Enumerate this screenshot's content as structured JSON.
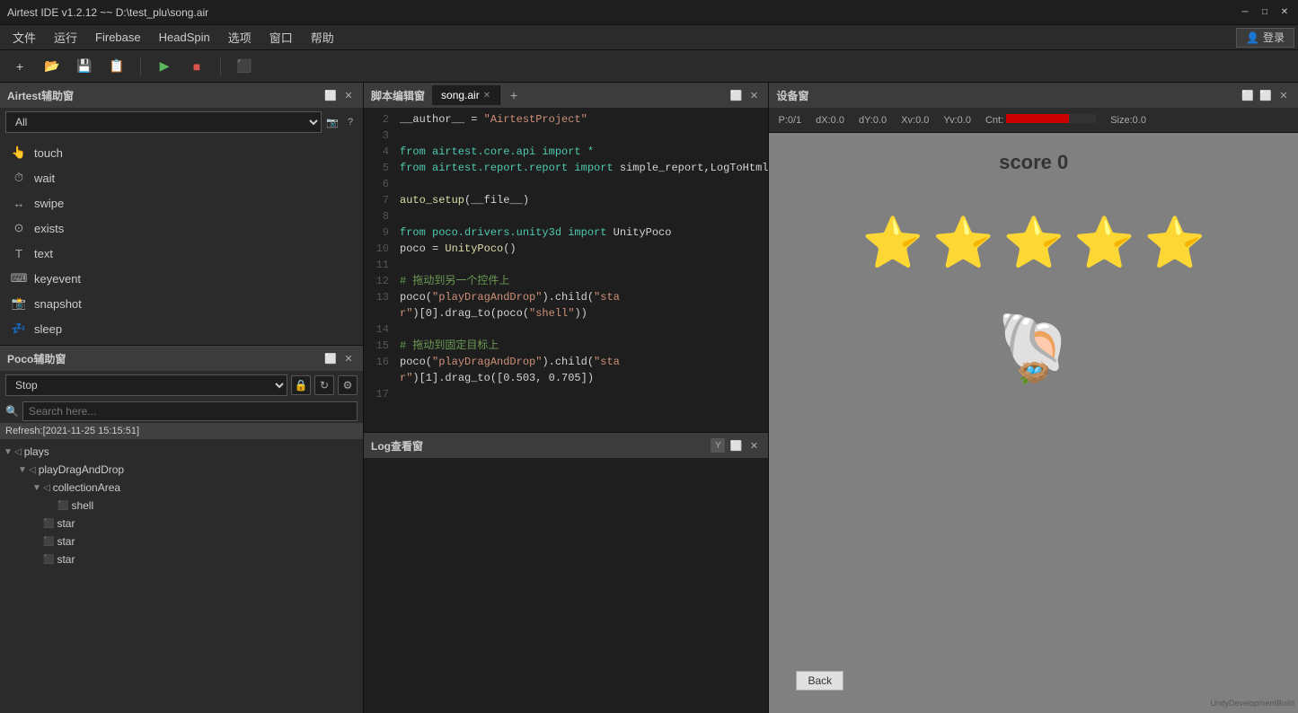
{
  "titleBar": {
    "title": "Airtest IDE v1.2.12 ~~ D:\\test_plu\\song.air",
    "minimize": "─",
    "maximize": "□",
    "close": "✕"
  },
  "menuBar": {
    "items": [
      "文件",
      "运行",
      "Firebase",
      "HeadSpin",
      "选项",
      "窗口",
      "帮助"
    ]
  },
  "toolbar": {
    "new_label": "+",
    "open_label": "📂",
    "save_label": "💾",
    "saveas_label": "📋",
    "run_label": "▶",
    "stop_label": "■",
    "record_label": "⬛",
    "login_label": "登录"
  },
  "airtestPanel": {
    "title": "Airtest辅助窗",
    "filterPlaceholder": "All",
    "items": [
      {
        "icon": "touch-icon",
        "label": "touch"
      },
      {
        "icon": "wait-icon",
        "label": "wait"
      },
      {
        "icon": "swipe-icon",
        "label": "swipe"
      },
      {
        "icon": "exists-icon",
        "label": "exists"
      },
      {
        "icon": "text-icon",
        "label": "text"
      },
      {
        "icon": "keyevent-icon",
        "label": "keyevent"
      },
      {
        "icon": "snapshot-icon",
        "label": "snapshot"
      },
      {
        "icon": "sleep-icon",
        "label": "sleep"
      }
    ]
  },
  "pocoPanel": {
    "title": "Poco辅助窗",
    "selectValue": "Stop",
    "searchPlaceholder": "Search here...",
    "refreshLabel": "Refresh:[2021-11-25 15:15:51]",
    "tree": [
      {
        "level": 0,
        "expanded": true,
        "icon": "▼",
        "nodeIcon": "▷",
        "label": "plays"
      },
      {
        "level": 1,
        "expanded": true,
        "icon": "▼",
        "nodeIcon": "▷",
        "label": "playDragAndDrop"
      },
      {
        "level": 2,
        "expanded": true,
        "icon": "▼",
        "nodeIcon": "◁",
        "label": "collectionArea"
      },
      {
        "level": 3,
        "expanded": false,
        "icon": "",
        "nodeIcon": "🖼",
        "label": "shell"
      },
      {
        "level": 2,
        "expanded": false,
        "icon": "",
        "nodeIcon": "🖼",
        "label": "star"
      },
      {
        "level": 2,
        "expanded": false,
        "icon": "",
        "nodeIcon": "🖼",
        "label": "star"
      },
      {
        "level": 2,
        "expanded": false,
        "icon": "",
        "nodeIcon": "🖼",
        "label": "star"
      }
    ]
  },
  "editorPanel": {
    "title": "脚本编辑窗",
    "activeTab": "song.air",
    "lines": [
      {
        "num": 2,
        "content": "__author__ = \"AirtestProject\"",
        "type": "string-assign"
      },
      {
        "num": 3,
        "content": "",
        "type": "blank"
      },
      {
        "num": 4,
        "content": "from airtest.core.api import *",
        "type": "import"
      },
      {
        "num": 5,
        "content": "from airtest.report.report import simple_report,LogToHtml",
        "type": "import"
      },
      {
        "num": 6,
        "content": "",
        "type": "blank"
      },
      {
        "num": 7,
        "content": "auto_setup(__file__)",
        "type": "call"
      },
      {
        "num": 8,
        "content": "",
        "type": "blank"
      },
      {
        "num": 9,
        "content": "from poco.drivers.unity3d import UnityPoco",
        "type": "import"
      },
      {
        "num": 10,
        "content": "poco = UnityPoco()",
        "type": "assign"
      },
      {
        "num": 11,
        "content": "",
        "type": "blank"
      },
      {
        "num": 12,
        "content": "# 拖动到另一个控件上",
        "type": "comment"
      },
      {
        "num": 13,
        "content": "poco(\"playDragAndDrop\").child(\"star\")[0].drag_to(poco(\"shell\"))",
        "type": "call"
      },
      {
        "num": 14,
        "content": "",
        "type": "blank"
      },
      {
        "num": 15,
        "content": "# 拖动到固定目标上",
        "type": "comment"
      },
      {
        "num": 16,
        "content": "poco(\"playDragAndDrop\").child(\"star\")[1].drag_to([0.503, 0.705])",
        "type": "call"
      },
      {
        "num": 17,
        "content": "",
        "type": "blank"
      }
    ]
  },
  "logPanel": {
    "title": "Log查看窗"
  },
  "devicePanel": {
    "title": "设备窗",
    "stats": [
      {
        "label": "P:0/1",
        "value": ""
      },
      {
        "label": "dX:0.0",
        "value": ""
      },
      {
        "label": "dY:0.0",
        "value": ""
      },
      {
        "label": "Xv:0.0",
        "value": ""
      },
      {
        "label": "Yv:0.0",
        "value": ""
      },
      {
        "label": "Cnt:",
        "value": "red-bar"
      },
      {
        "label": "Size:0.0",
        "value": ""
      }
    ],
    "game": {
      "scoreLabel": "score  0",
      "stars": [
        "⭐",
        "⭐",
        "⭐",
        "⭐",
        "⭐"
      ],
      "shellEmoji": "🐚",
      "backButton": "Back",
      "watermark": "UnityDevelopmentBuild"
    }
  }
}
